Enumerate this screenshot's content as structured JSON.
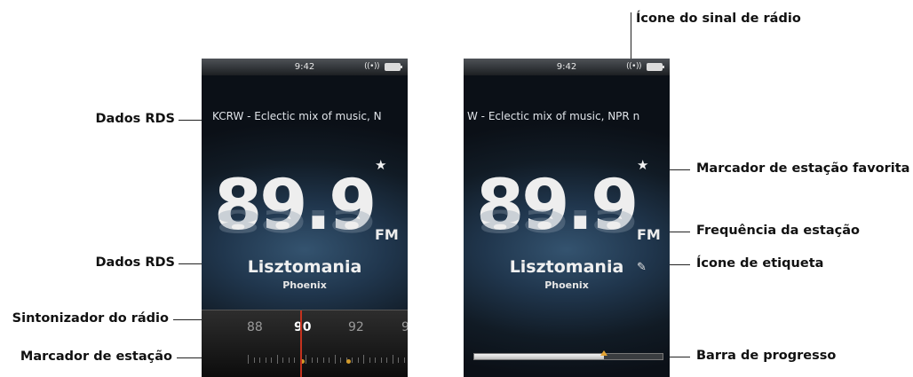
{
  "callouts": {
    "dados_rds_top": "Dados RDS",
    "dados_rds_bottom": "Dados RDS",
    "sintonizador": "Sintonizador do rádio",
    "marcador_estacao": "Marcador de estação",
    "icone_sinal": "Ícone do sinal de rádio",
    "marcador_favorita": "Marcador de estação favorita",
    "frequencia": "Frequência da estação",
    "icone_etiqueta": "Ícone de etiqueta",
    "barra_progresso": "Barra de progresso"
  },
  "left_screen": {
    "time": "9:42",
    "signal_glyph": "((•))",
    "rds_text": "KCRW - Eclectic mix of music, N",
    "frequency": "89.9",
    "band": "FM",
    "favorite_glyph": "★",
    "song": "Lisztomania",
    "artist": "Phoenix",
    "tuner_labels": [
      "88",
      "90",
      "92",
      "9"
    ],
    "tuner_selected": "90"
  },
  "right_screen": {
    "time": "9:42",
    "signal_glyph": "((•))",
    "rds_text": "W - Eclectic mix of music, NPR n",
    "frequency": "89.9",
    "band": "FM",
    "favorite_glyph": "★",
    "song": "Lisztomania",
    "artist": "Phoenix",
    "tag_glyph": "✎",
    "progress_fraction": 0.69
  },
  "colors": {
    "needle": "#c4321e",
    "station_dot": "#d19a2a",
    "progress_thumb": "#e4a433"
  },
  "icons": {
    "signal": "radio-signal-icon",
    "battery": "battery-icon",
    "favorite": "star-icon",
    "tag": "tag-icon"
  }
}
